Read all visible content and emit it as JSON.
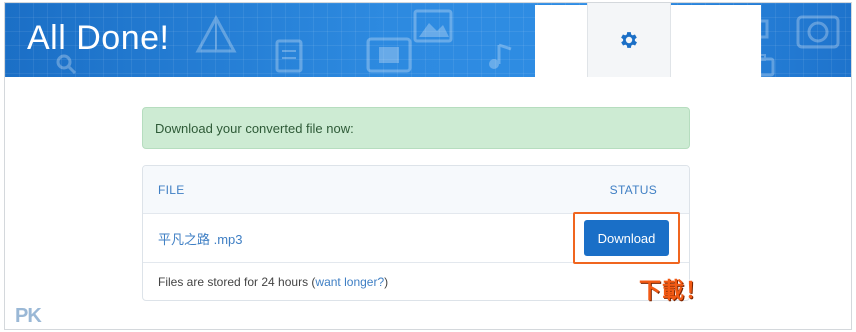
{
  "banner": {
    "title": "All Done!"
  },
  "notice": {
    "text": "Download your converted file now:"
  },
  "table": {
    "headers": {
      "file": "FILE",
      "status": "STATUS"
    },
    "file_name": "平凡之路 .mp3",
    "download_label": "Download",
    "footer_text": "Files are stored for 24 hours",
    "footer_link": "want longer?"
  },
  "annotation": {
    "text": "下載！"
  },
  "watermark": {
    "text": "PK"
  },
  "colors": {
    "banner_blue": "#2d8ae0",
    "notice_green": "#cdebd3",
    "button_blue": "#1a6fc7",
    "highlight_orange": "#f0651f",
    "link_blue": "#3f7fc4"
  },
  "icons": [
    "settings-gear-icon",
    "document-icon",
    "photo-icon",
    "film-icon",
    "folder-icon",
    "music-icon"
  ]
}
